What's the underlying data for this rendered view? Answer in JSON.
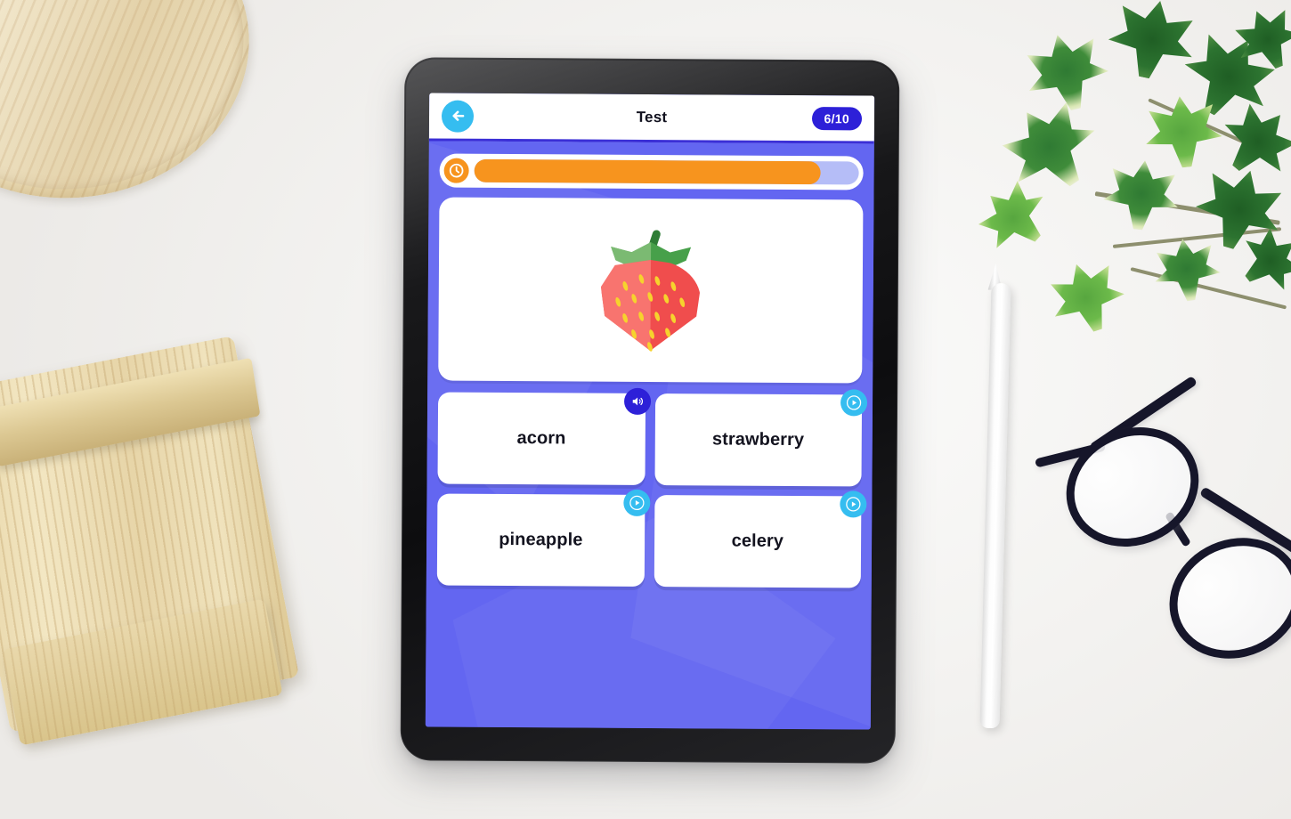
{
  "app": {
    "header": {
      "back_icon": "arrow-left-icon",
      "title": "Test",
      "progress_badge": "6/10"
    },
    "timer": {
      "icon": "clock-icon",
      "percent_remaining": 90
    },
    "question": {
      "image_alt": "strawberry",
      "image_kind": "strawberry-illustration"
    },
    "answers": [
      {
        "label": "acorn",
        "audio_icon": "speaker-icon",
        "audio_state": "playing"
      },
      {
        "label": "strawberry",
        "audio_icon": "play-icon",
        "audio_state": "idle"
      },
      {
        "label": "pineapple",
        "audio_icon": "play-icon",
        "audio_state": "idle"
      },
      {
        "label": "celery",
        "audio_icon": "play-icon",
        "audio_state": "idle"
      }
    ]
  },
  "colors": {
    "screen_background": "#6366f1",
    "header_background": "#ffffff",
    "badge_background": "#2d20d8",
    "back_button": "#35bdf0",
    "timer_fill": "#f7941e",
    "timer_track": "#b5bdf7",
    "card_background": "#ffffff",
    "text_dark": "#13131f",
    "play_icon": "#35bdf0",
    "playing_icon": "#2d20d8"
  },
  "scene": {
    "desk_color": "#f2f1ef",
    "objects": [
      {
        "name": "round-wooden-tray"
      },
      {
        "name": "bamboo-block"
      },
      {
        "name": "ivy-plant"
      },
      {
        "name": "stylus-pen"
      },
      {
        "name": "eyeglasses"
      },
      {
        "name": "tablet-device"
      }
    ]
  }
}
